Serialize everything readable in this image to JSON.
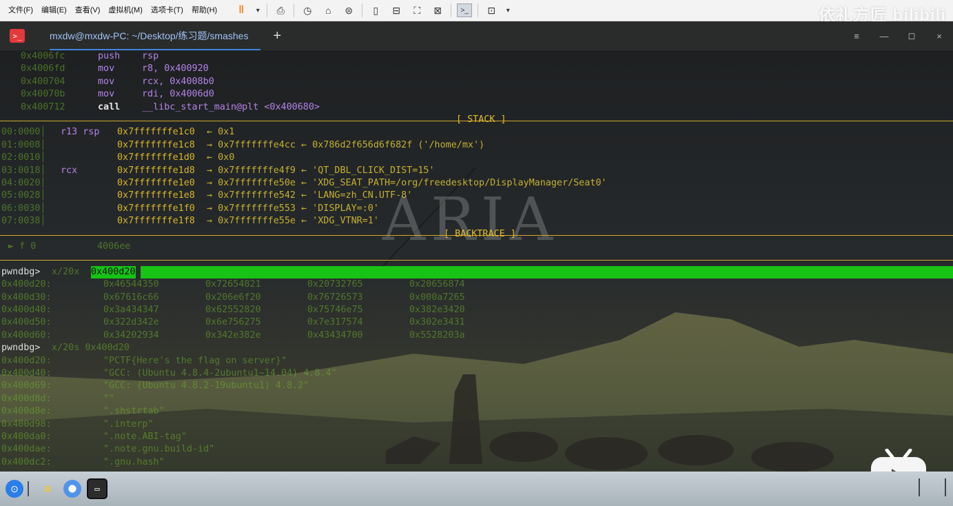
{
  "vm_menu": [
    "文件(F)",
    "编辑(E)",
    "查看(V)",
    "虚拟机(M)",
    "选项卡(T)",
    "帮助(H)"
  ],
  "vm_toolbar_icons": [
    "pause-icon",
    "dropdown-icon",
    "send-ctrl-alt-del-icon",
    "snapshot-icon",
    "revert-snapshot-icon",
    "snapshot-manager-icon",
    "view-icon",
    "unity-icon",
    "fullscreen-icon",
    "stretch-icon",
    "console-icon",
    "settings-icon"
  ],
  "watermark_logo": "依礼方匠 bilibili",
  "terminal": {
    "tab_title": "mxdw@mxdw-PC: ~/Desktop/练习题/smashes",
    "add_tab": "+",
    "window_controls": [
      "≡",
      "—",
      "◻",
      "×"
    ]
  },
  "disasm": [
    {
      "addr": "0x4006fc",
      "op": "push",
      "args": "rsp"
    },
    {
      "addr": "0x4006fd",
      "op": "mov",
      "args": "r8, 0x400920"
    },
    {
      "addr": "0x400704",
      "op": "mov",
      "args": "rcx, 0x4008b0"
    },
    {
      "addr": "0x40070b",
      "op": "mov",
      "args": "rdi, 0x4006d0"
    },
    {
      "addr": "0x400712",
      "op": "call",
      "args": "__libc_start_main@plt <0x400680>"
    }
  ],
  "stack_label": "[ STACK ]",
  "stack": [
    {
      "off": "00:0000",
      "reg": "r13 rsp",
      "ptr": "0x7fffffffe1c0",
      "chain": "← 0x1"
    },
    {
      "off": "01:0008",
      "reg": "",
      "ptr": "0x7fffffffe1c8",
      "chain": "→ 0x7fffffffe4cc ← 0x786d2f656d6f682f ('/home/mx')"
    },
    {
      "off": "02:0010",
      "reg": "",
      "ptr": "0x7fffffffe1d0",
      "chain": "← 0x0"
    },
    {
      "off": "03:0018",
      "reg": "rcx",
      "ptr": "0x7fffffffe1d8",
      "chain": "→ 0x7fffffffe4f9 ← 'QT_DBL_CLICK_DIST=15'"
    },
    {
      "off": "04:0020",
      "reg": "",
      "ptr": "0x7fffffffe1e0",
      "chain": "→ 0x7fffffffe50e ← 'XDG_SEAT_PATH=/org/freedesktop/DisplayManager/Seat0'"
    },
    {
      "off": "05:0028",
      "reg": "",
      "ptr": "0x7fffffffe1e8",
      "chain": "→ 0x7fffffffe542 ← 'LANG=zh_CN.UTF-8'"
    },
    {
      "off": "06:0030",
      "reg": "",
      "ptr": "0x7fffffffe1f0",
      "chain": "→ 0x7fffffffe553 ← 'DISPLAY=:0'"
    },
    {
      "off": "07:0038",
      "reg": "",
      "ptr": "0x7fffffffe1f8",
      "chain": "→ 0x7fffffffe55e ← 'XDG_VTNR=1'"
    }
  ],
  "backtrace_label": "[ BACKTRACE ]",
  "backtrace": "► f 0           4006ee",
  "cmd1": {
    "prompt": "pwndbg>",
    "cmd": "x/20x",
    "arg": "0x400d20"
  },
  "hexdump": [
    {
      "addr": "0x400d20:",
      "words": [
        "0x46544350",
        "0x72654821",
        "0x20732765",
        "0x20656874"
      ]
    },
    {
      "addr": "0x400d30:",
      "words": [
        "0x67616c66",
        "0x206e6f20",
        "0x76726573",
        "0x000a7265"
      ]
    },
    {
      "addr": "0x400d40:",
      "words": [
        "0x3a434347",
        "0x62552820",
        "0x75746e75",
        "0x382e3420"
      ]
    },
    {
      "addr": "0x400d50:",
      "words": [
        "0x322d342e",
        "0x6e756275",
        "0x7e317574",
        "0x302e3431"
      ]
    },
    {
      "addr": "0x400d60:",
      "words": [
        "0x34202934",
        "0x342e382e",
        "0x43434700",
        "0x5528203a"
      ]
    }
  ],
  "cmd2": {
    "prompt": "pwndbg>",
    "cmd": "x/20s 0x400d20"
  },
  "strings": [
    {
      "addr": "0x400d20:",
      "val": "\"PCTF{Here's the flag on server}\""
    },
    {
      "addr": "0x400d40:",
      "val": "\"GCC: (Ubuntu 4.8.4-2ubuntu1~14.04) 4.8.4\""
    },
    {
      "addr": "0x400d69:",
      "val": "\"GCC: (Ubuntu 4.8.2-19ubuntu1) 4.8.2\""
    },
    {
      "addr": "0x400d8d:",
      "val": "\"\""
    },
    {
      "addr": "0x400d8e:",
      "val": "\".shstrtab\""
    },
    {
      "addr": "0x400d98:",
      "val": "\".interp\""
    },
    {
      "addr": "0x400da0:",
      "val": "\".note.ABI-tag\""
    },
    {
      "addr": "0x400dae:",
      "val": "\".note.gnu.build-id\""
    },
    {
      "addr": "0x400dc2:",
      "val": "\".gnu.hash\""
    }
  ],
  "overlay_watermark": "ARIA",
  "taskbar_icons": [
    "launcher-icon",
    "file-manager-icon",
    "browser-icon",
    "terminal-icon"
  ],
  "play_icon": "bilibili-play-icon",
  "colors": {
    "accent_tab": "#3f86e0",
    "pwndbg_yellow": "#d1a82c",
    "highlight_green": "#17c314",
    "code_green": "#7ccc35"
  }
}
